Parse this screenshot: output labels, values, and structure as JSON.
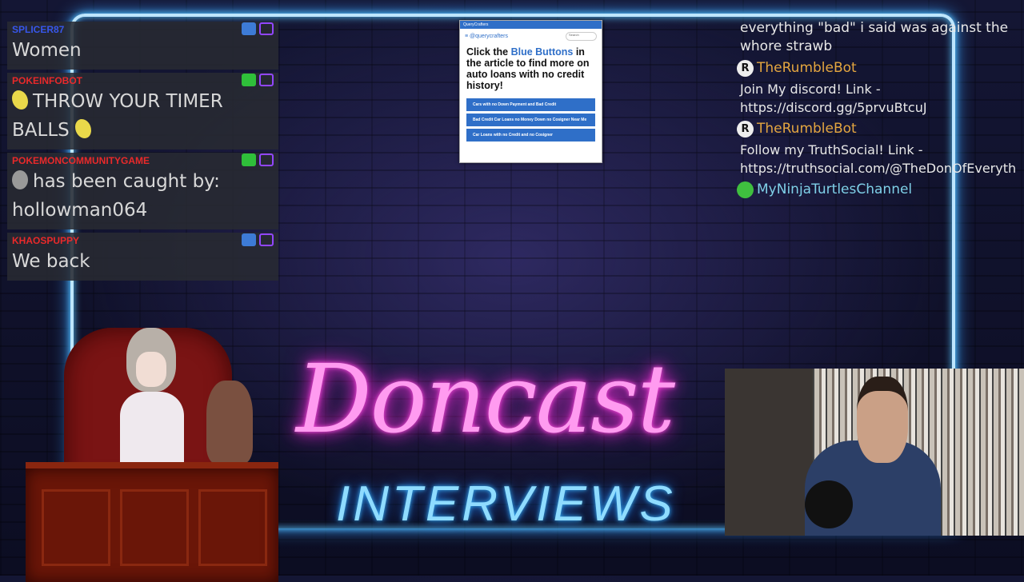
{
  "left_chat": [
    {
      "user": "SPLICER87",
      "color": "#3a5cff",
      "badges": [
        "crown-icon",
        "twitch-icon"
      ],
      "text": "Women",
      "emote": false
    },
    {
      "user": "POKEINFOBOT",
      "color": "#ff2a2a",
      "badges": [
        "sword-icon",
        "twitch-icon"
      ],
      "text": "THROW YOUR TIMER BALLS",
      "emote": true
    },
    {
      "user": "POKEMONCOMMUNITYGAME",
      "color": "#ff2a2a",
      "badges": [
        "sword-icon",
        "twitch-icon"
      ],
      "text": "has been caught by: hollowman064",
      "emote": true
    },
    {
      "user": "KHAOSPUPPY",
      "color": "#ff2a2a",
      "badges": [
        "crown-icon",
        "twitch-icon"
      ],
      "text": "We back",
      "emote": false
    }
  ],
  "ad": {
    "window_title": "QueryCrafters",
    "brand": "@querycrafters",
    "search_placeholder": "Search",
    "headline_pre": "Click the ",
    "headline_blue": "Blue Buttons",
    "headline_post": " in the article to find more on auto loans with no credit history!",
    "buttons": [
      "Cars with no Down Payment and Bad Credit",
      "Bad Credit Car Loans no Money Down no Cosigner Near Me",
      "Car Loans with no Credit and no Cosigner"
    ]
  },
  "right_chat": {
    "line1": "everything \"bad\" i said was against the",
    "line2": "whore strawb",
    "msg1_user": "TheRumbleBot",
    "msg1_line1": "Join My discord! Link -",
    "msg1_line2": "https://discord.gg/5prvuBtcuJ",
    "msg2_user": "TheRumbleBot",
    "msg2_line1": "Follow my TruthSocial! Link -",
    "msg2_line2": "https://truthsocial.com/@TheDonOfEveryth",
    "msg3_user": "MyNinjaTurtlesChannel"
  },
  "logo": {
    "script": "Doncast",
    "sub": "INTERVIEWS"
  },
  "colors": {
    "neon_blue": "#bde6ff",
    "neon_pink": "#ff9bf0",
    "chat_bg": "#282a32",
    "rumble_name": "#e4a640"
  }
}
